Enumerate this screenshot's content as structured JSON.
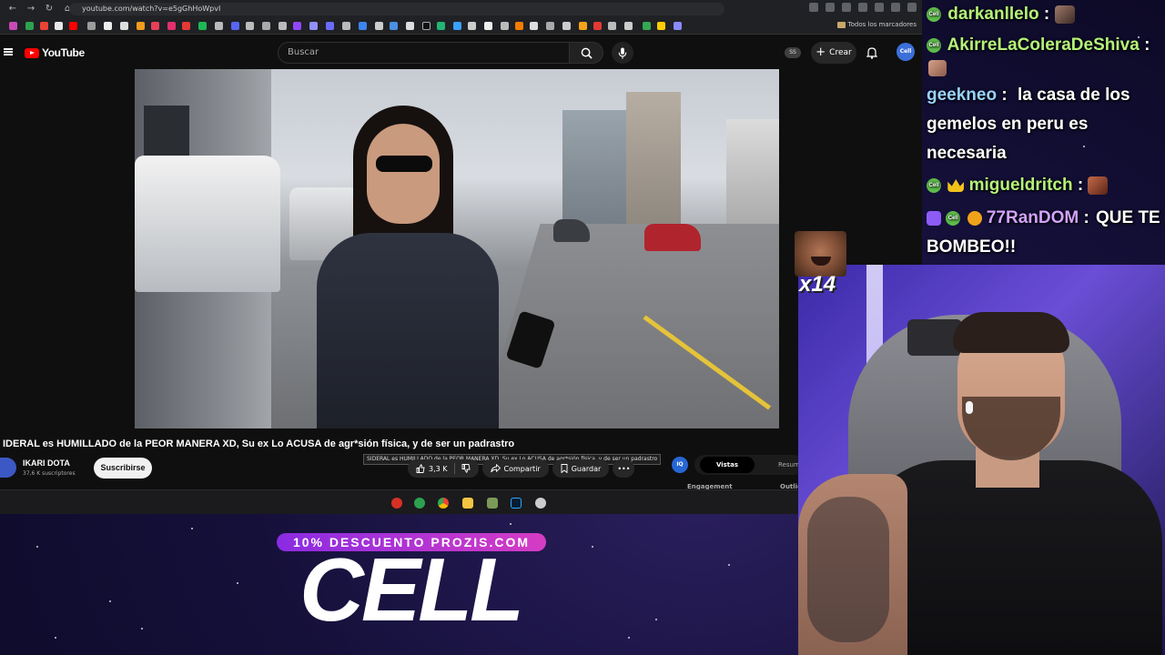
{
  "browser": {
    "url": "youtube.com/watch?v=e5gGhHoWpvI",
    "bookmarks_folder": "Todos los marcadores"
  },
  "youtube": {
    "logo_text": "YouTube",
    "search_placeholder": "Buscar",
    "ss_badge": "SS",
    "create_label": "Crear",
    "avatar_text": "Cell"
  },
  "video": {
    "title": "IDERAL es HUMILLADO de la PEOR MANERA XD, Su ex Lo ACUSA de agr*sión física, y de ser un padrastro",
    "tooltip": "SIDERAL es HUMILLADO de la PEOR MANERA XD, Su ex Lo ACUSA de agr*sión física, y de ser un padrastro",
    "channel_name": "IKARI DOTA",
    "subscribers": "37,6 K suscriptores",
    "subscribe_label": "Suscribirse",
    "likes": "3,3 K",
    "share_label": "Compartir",
    "save_label": "Guardar",
    "more_label": "•••"
  },
  "side_panel": {
    "iq_label": "IQ",
    "tab_active": "Vistas",
    "tab_other": "Resum",
    "sub_left": "Engagement",
    "sub_right": "Outlie"
  },
  "chat": {
    "messages": [
      {
        "user": "darkanllelo",
        "user_color": "#b5f27a",
        "separator": " :",
        "text": ""
      },
      {
        "user": "AkirreLaColeraDeShiva",
        "user_color": "#b5f27a",
        "separator": " :",
        "text": ""
      },
      {
        "user": "geekneo",
        "user_color": "#9ad3ff",
        "separator": " :",
        "text": "la casa de los gemelos en peru es necesaria"
      },
      {
        "user": "migueldritch",
        "user_color": "#b5f27a",
        "separator": " :",
        "text": ""
      },
      {
        "user": "77RanDOM",
        "user_color": "#d2a2ff",
        "separator": " :",
        "text": "QUE TE BOMBEO!!"
      }
    ]
  },
  "emote_combo": {
    "count_label": "x14"
  },
  "sponsor": {
    "banner": "10% DESCUENTO PROZIS.COM",
    "name": "CELL"
  },
  "colors": {
    "youtube_red": "#ff0000",
    "chat_green": "#b5f27a",
    "chat_blue": "#9ad3ff",
    "chat_purple": "#d2a2ff",
    "sponsor_gradient_start": "#8a2be2",
    "sponsor_gradient_end": "#d63cc4"
  }
}
